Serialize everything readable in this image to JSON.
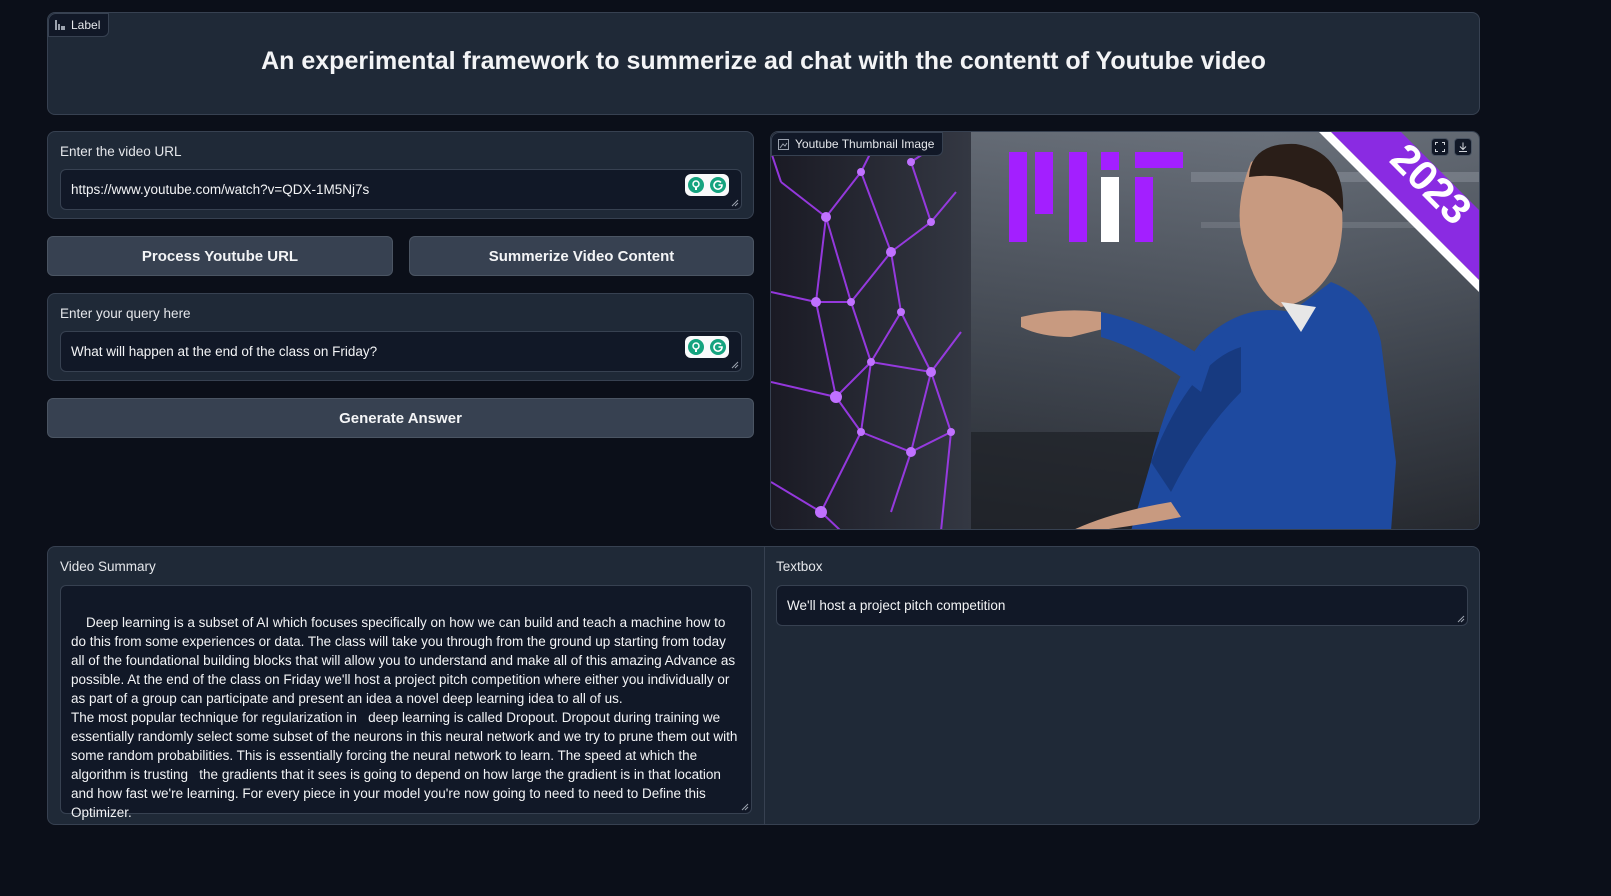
{
  "header": {
    "badge_label": "Label",
    "title": "An experimental framework to summerize ad chat with the contentt of Youtube video"
  },
  "url_input": {
    "label": "Enter the video URL",
    "value": "https://www.youtube.com/watch?v=QDX-1M5Nj7s"
  },
  "buttons": {
    "process": "Process Youtube URL",
    "summarize": "Summerize Video Content",
    "generate": "Generate Answer"
  },
  "query_input": {
    "label": "Enter your query here",
    "value": "What will happen at the end of the class on Friday?"
  },
  "thumbnail": {
    "label": "Youtube Thumbnail Image",
    "banner_text": "2023",
    "logo_text": "MIT",
    "colors": {
      "purple": "#8a2be2",
      "sweater": "#1e4aa0"
    }
  },
  "summary": {
    "label": "Video Summary",
    "text": "Deep learning is a subset of AI which focuses specifically on how we can build and teach a machine how to do this from some experiences or data. The class will take you through from the ground up starting from today all of the foundational building blocks that will allow you to understand and make all of this amazing Advance as possible. At the end of the class on Friday we'll host a project pitch competition where either you individually or as part of a group can participate and present an idea a novel deep learning idea to all of us.\nThe most popular technique for regularization in   deep learning is called Dropout. Dropout during training we essentially randomly select some subset of the neurons in this neural network and we try to prune them out with some random probabilities. This is essentially forcing the neural network to learn. The speed at which the algorithm is trusting   the gradients that it sees is going to depend on how large the gradient is in that location and how fast we're learning. For every piece in your model you're now going to need to need to Define this Optimizer."
  },
  "answer": {
    "label": "Textbox",
    "value": "We'll host a project pitch competition"
  }
}
